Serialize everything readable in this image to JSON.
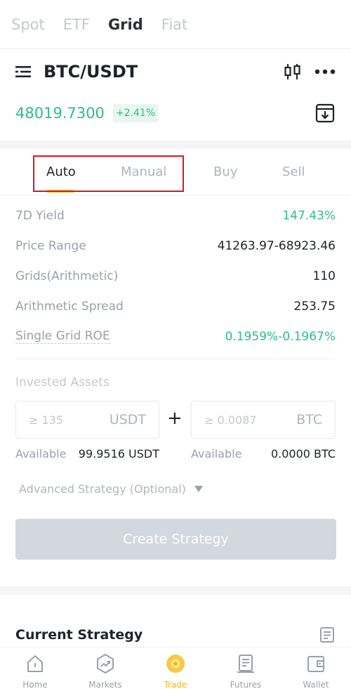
{
  "top_tabs": {
    "spot": "Spot",
    "etf": "ETF",
    "grid": "Grid",
    "fiat": "Fiat"
  },
  "pair": {
    "name": "BTC/USDT",
    "price": "48019.7300",
    "change": "+2.41%"
  },
  "sub_tabs": {
    "auto": "Auto",
    "manual": "Manual",
    "buy": "Buy",
    "sell": "Sell"
  },
  "info": {
    "yield_label": "7D Yield",
    "yield_value": "147.43%",
    "range_label": "Price Range",
    "range_value": "41263.97-68923.46",
    "grids_label": "Grids(Arithmetic)",
    "grids_value": "110",
    "spread_label": "Arithmetic Spread",
    "spread_value": "253.75",
    "roe_label": "Single Grid ROE",
    "roe_value": "0.1959%-0.1967%"
  },
  "invest": {
    "label": "Invested Assets",
    "usdt_placeholder": "≥ 135",
    "usdt_unit": "USDT",
    "btc_placeholder": "≥ 0.0087",
    "btc_unit": "BTC",
    "plus": "+",
    "available_label": "Available",
    "usdt_available": "99.9516 USDT",
    "btc_available": "0.0000 BTC"
  },
  "advanced_label": "Advanced Strategy (Optional)",
  "create_button": "Create Strategy",
  "current_strategy": "Current Strategy",
  "nav": {
    "home": "Home",
    "markets": "Markets",
    "trade": "Trade",
    "futures": "Futures",
    "wallet": "Wallet"
  },
  "colors": {
    "green": "#2ebd85",
    "accent": "#f0b90b",
    "highlight": "#e0141e",
    "button_disabled": "#d3d7df"
  },
  "icons": [
    "menu-icon",
    "candlestick-icon",
    "more-icon",
    "download-icon",
    "document-icon",
    "home-icon",
    "markets-icon",
    "trade-icon",
    "futures-icon",
    "wallet-icon"
  ]
}
